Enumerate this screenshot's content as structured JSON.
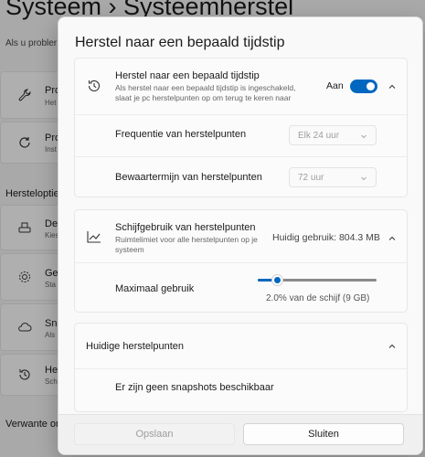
{
  "background": {
    "title": "Systeem  ›  Systeemherstel",
    "subtitle": "Als u probler",
    "cards": [
      {
        "l1": "Pro",
        "l2": "Het",
        "icon": "wrench-icon"
      },
      {
        "l1": "Pro",
        "l2": "Inst",
        "icon": "refresh-icon"
      },
      {
        "l1": "De",
        "l2": "Kies",
        "icon": "drive-icon"
      },
      {
        "l1": "Ge",
        "l2": "Sta",
        "icon": "gear-icon"
      },
      {
        "l1": "Sn",
        "l2": "Als",
        "icon": "cloud-icon"
      },
      {
        "l1": "He",
        "l2": "Sch",
        "icon": "history-icon"
      }
    ],
    "section_options": "Hersteloptie",
    "section_related": "Verwante or"
  },
  "dialog": {
    "title": "Herstel naar een bepaald tijdstip",
    "restore": {
      "heading": "Herstel naar een bepaald tijdstip",
      "description": "Als herstel naar een bepaald tijdstip is ingeschakeld, slaat je pc herstelpunten op om terug te keren naar",
      "toggle_label": "Aan",
      "toggle_on": true,
      "frequency_label": "Frequentie van herstelpunten",
      "frequency_value": "Elk 24 uur",
      "retention_label": "Bewaartermijn van herstelpunten",
      "retention_value": "72 uur"
    },
    "disk": {
      "heading": "Schijfgebruik van herstelpunten",
      "description": "Ruimtelimiet voor alle herstelpunten op je systeem",
      "current_usage": "Huidig gebruik: 804.3 MB",
      "max_label": "Maximaal gebruik",
      "slider_fraction": 0.17,
      "slider_caption": "2.0% van de schijf (9 GB)"
    },
    "current": {
      "heading": "Huidige herstelpunten",
      "empty_message": "Er zijn geen snapshots beschikbaar"
    },
    "buttons": {
      "save": "Opslaan",
      "close": "Sluiten"
    }
  },
  "colors": {
    "accent": "#0067c0"
  }
}
